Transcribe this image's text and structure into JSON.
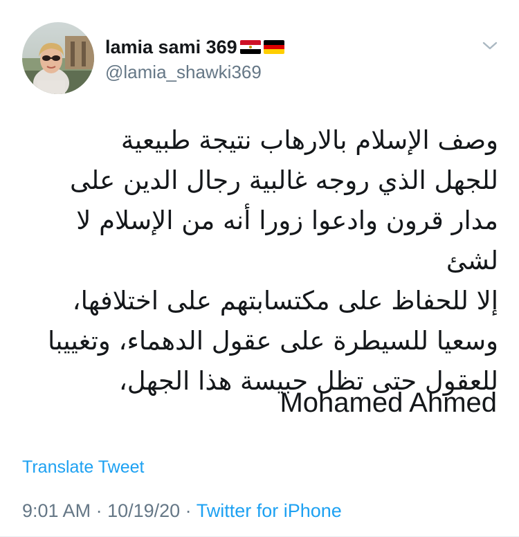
{
  "user": {
    "display_name": "lamia sami 369",
    "handle": "@lamia_shawki369",
    "avatar_icon": "profile-photo",
    "flags": [
      "egypt-flag",
      "germany-flag"
    ]
  },
  "menu": {
    "icon": "chevron-down-icon",
    "color": "#aab8c2"
  },
  "tweet": {
    "text": "وصف الإسلام بالارهاب نتيجة طبيعية\nللجهل الذي روجه غالبية رجال الدين على\nمدار قرون وادعوا زورا أنه من الإسلام لا لشئ\nإلا للحفاظ على مكتسابتهم على اختلافها،\nوسعيا للسيطرة على عقول الدهماء، وتغييبا\nللعقول حتى تظل حبيسة هذا الجهل،",
    "signature": "Mohamed Ahmed"
  },
  "actions": {
    "translate_label": "Translate Tweet"
  },
  "meta": {
    "time": "9:01 AM",
    "separator1": " · ",
    "date": "10/19/20",
    "separator2": " · ",
    "source": "Twitter for iPhone"
  },
  "colors": {
    "link": "#1da1f2",
    "secondary_text": "#657786",
    "primary_text": "#14171a"
  }
}
